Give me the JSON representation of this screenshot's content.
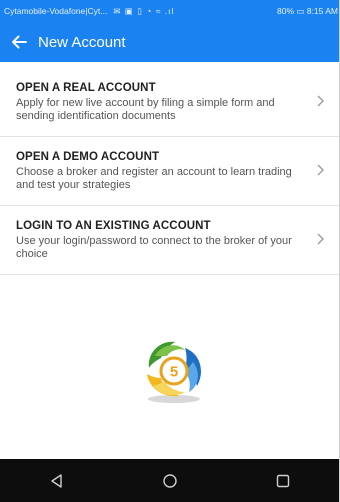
{
  "status_bar": {
    "carrier": "Cytamobile-Vodafone|Cyt...",
    "icons": "✉ ▣ ▯ ◔ ≈ .ıl",
    "battery_time": "80% ▭ 8:15 AM"
  },
  "app_bar": {
    "back_icon": "arrow-left-icon",
    "title": "New Account"
  },
  "options": [
    {
      "title": "OPEN A REAL ACCOUNT",
      "description": "Apply for new live account by filing a simple form and sending identification documents"
    },
    {
      "title": "OPEN A DEMO ACCOUNT",
      "description": "Choose a broker and register an account to learn trading and test your strategies"
    },
    {
      "title": "LOGIN TO AN EXISTING ACCOUNT",
      "description": "Use your login/password to connect to the broker of your choice"
    }
  ],
  "logo": {
    "number": "5",
    "icon": "metatrader-logo"
  },
  "nav_bar": {
    "back": "back-triangle-icon",
    "home": "home-circle-icon",
    "recents": "recents-square-icon"
  },
  "colors": {
    "accent": "#1b82f2",
    "nav": "#0d0d0d"
  }
}
